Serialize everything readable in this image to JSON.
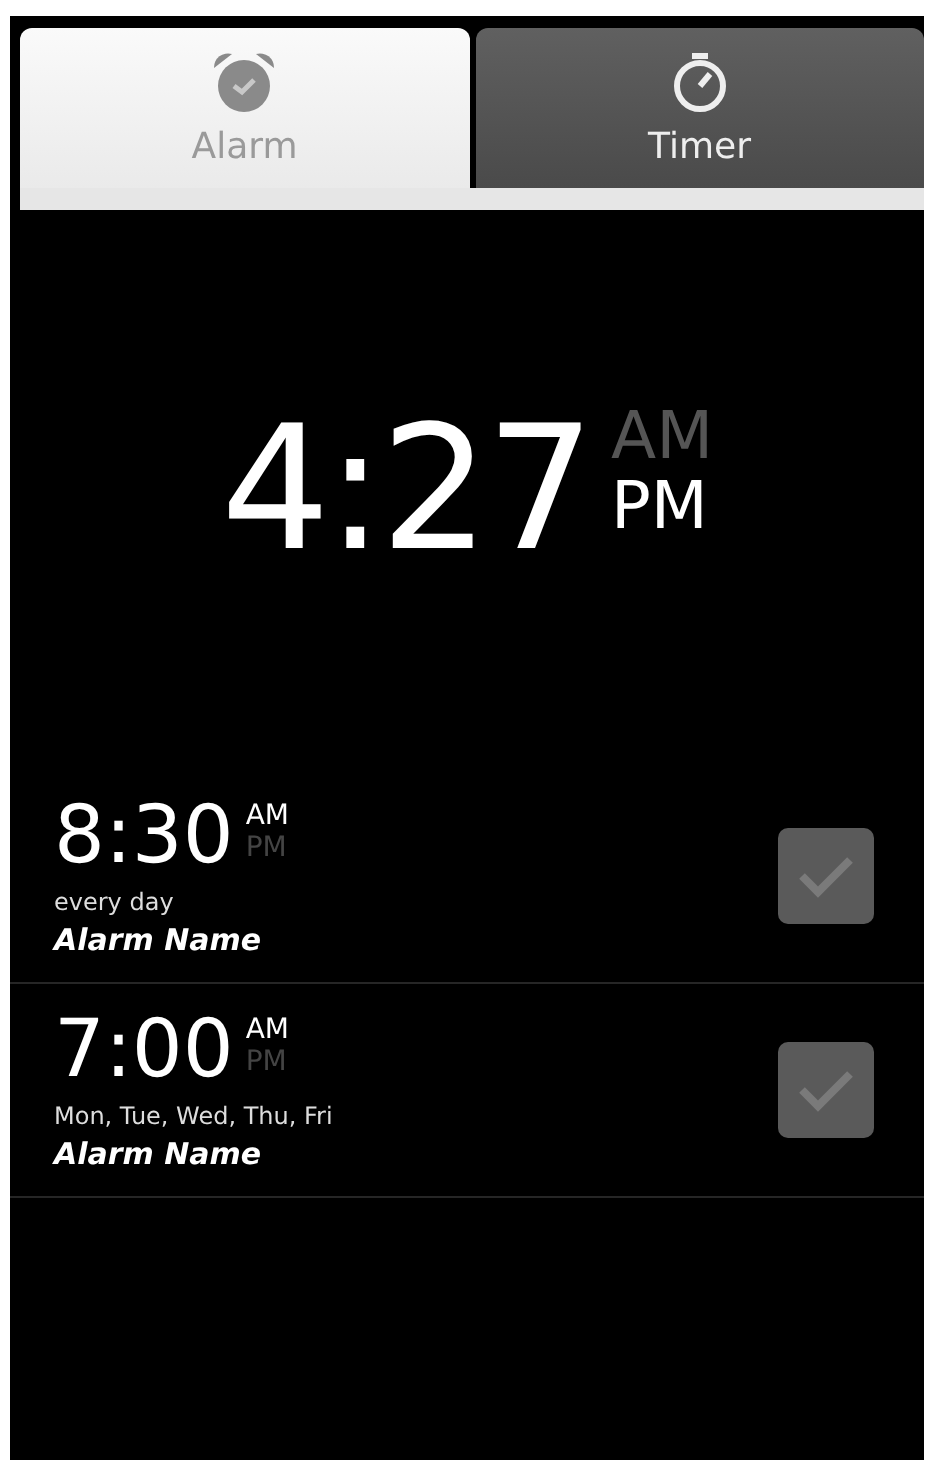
{
  "tabs": [
    {
      "label": "Alarm",
      "kind": "alarm",
      "selected": true
    },
    {
      "label": "Timer",
      "kind": "timer",
      "selected": false
    }
  ],
  "clock": {
    "time": "4:27",
    "periods": [
      {
        "label": "AM",
        "selected": false
      },
      {
        "label": "PM",
        "selected": true
      }
    ]
  },
  "alarms": [
    {
      "time": "8:30",
      "periods": [
        {
          "label": "AM",
          "selected": true
        },
        {
          "label": "PM",
          "selected": false
        }
      ],
      "repeat": "every day",
      "name": "Alarm Name",
      "checked": false
    },
    {
      "time": "7:00",
      "periods": [
        {
          "label": "AM",
          "selected": true
        },
        {
          "label": "PM",
          "selected": false
        }
      ],
      "repeat": "Mon, Tue, Wed, Thu, Fri",
      "name": "Alarm Name",
      "checked": false
    }
  ]
}
